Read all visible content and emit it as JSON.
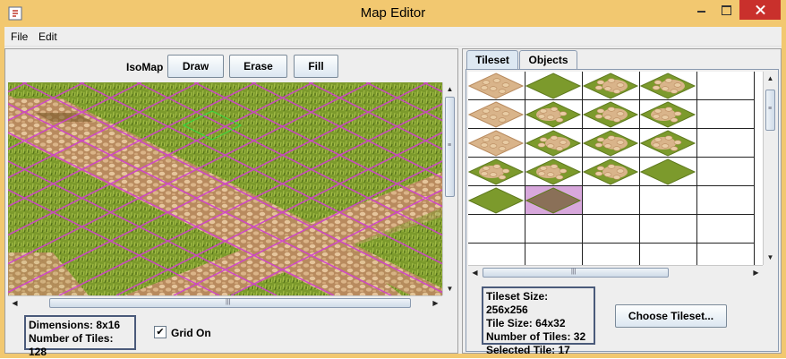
{
  "window": {
    "title": "Map Editor"
  },
  "menu": {
    "file": "File",
    "edit": "Edit"
  },
  "toolbar": {
    "label": "IsoMap",
    "draw": "Draw",
    "erase": "Erase",
    "fill": "Fill"
  },
  "map_info": {
    "dimensions": "Dimensions: 8x16",
    "tiles": "Number of Tiles: 128"
  },
  "grid_toggle": {
    "label": "Grid On",
    "checked": true,
    "check_mark": "✔"
  },
  "tabs": {
    "tileset": "Tileset",
    "objects": "Objects",
    "active": "Tileset"
  },
  "tileset_info": {
    "size": "Tileset Size: 256x256",
    "tile_size": "Tile Size: 64x32",
    "count": "Number of Tiles: 32",
    "selected": "Selected Tile: 17"
  },
  "tileset_palette": [
    "cobble",
    "grass",
    "grass-cobble",
    "grass-cobble",
    "cobble",
    "cobble-grass",
    "grass-cobble",
    "cobble-grass",
    "cobble",
    "grass-cobble",
    "grass-cobble",
    "cobble-grass",
    "cobble-grass",
    "cobble-grass",
    "grass-cobble",
    "grass",
    "grass",
    "selected-tile"
  ],
  "buttons": {
    "choose_tileset": "Choose Tileset..."
  },
  "colors": {
    "title_bar": "#f2c870",
    "close_button": "#c9302c",
    "grass": "#7c9a2c",
    "grass_dark": "#5f7a1e",
    "cobble": "#d9b48a",
    "cobble_dark": "#b88a5e",
    "grid_line": "#d040d0",
    "selection_highlight": "#d8a8dc"
  }
}
